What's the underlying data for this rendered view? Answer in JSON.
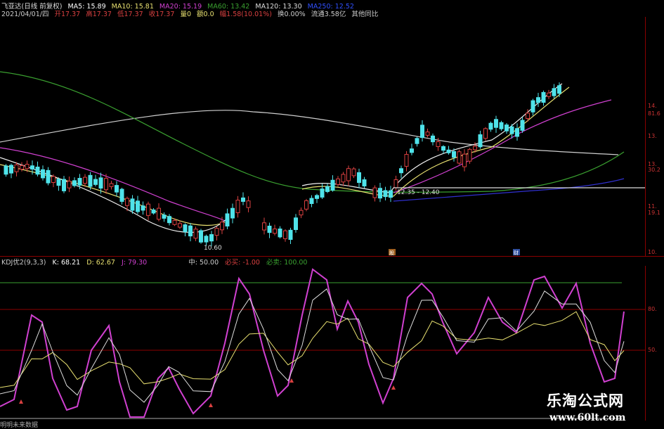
{
  "header": {
    "row1": {
      "stock": "飞亚达(日线 前复权)",
      "ma5": "MA5: 15.89",
      "ma10": "MA10: 15.81",
      "ma20": "MA20: 15.19",
      "ma60": "MA60: 13.42",
      "ma120": "MA120: 13.30",
      "ma250": "MA250: 12.52"
    },
    "row2": {
      "date": "2021/04/01/四",
      "open": "开17.37",
      "high": "高17.37",
      "low": "低17.37",
      "close": "收17.37",
      "volume": "量0",
      "amount": "额0.0",
      "change": "幅1.58(10.01%)",
      "turnover": "换0.00%",
      "float_cap": "流通3.58亿",
      "other": "其他同比"
    }
  },
  "main_chart": {
    "annotations": {
      "low_label": "10.60",
      "range_label": "12.35 - 12.40"
    },
    "markers": [
      "股",
      "财"
    ]
  },
  "main_axis": [
    "14.",
    "81.6",
    "13.",
    "13.",
    "30.2",
    "11.",
    "19.1",
    "10."
  ],
  "kdj": {
    "name": "KDJ优2(9,3,3)",
    "k": "K: 68.21",
    "d": "D: 62.67",
    "j": "J: 79.30",
    "mid": "中: 50.00",
    "buy": "必买: -1.00",
    "sell": "必卖: 100.00"
  },
  "kdj_axis": [
    "80.",
    "50."
  ],
  "status": "明明未来数据",
  "watermark": {
    "cn": "乐淘公式网",
    "url": "www.60lt.com"
  },
  "colors": {
    "up": "#d94040",
    "down": "#4fe3ea",
    "ma_white": "#d8d8d8",
    "ma_yellow": "#e8e070",
    "ma_magenta": "#d040d0",
    "ma_green": "#3aa030",
    "ma_blue": "#3030d0",
    "grid": "#8b0000"
  }
}
